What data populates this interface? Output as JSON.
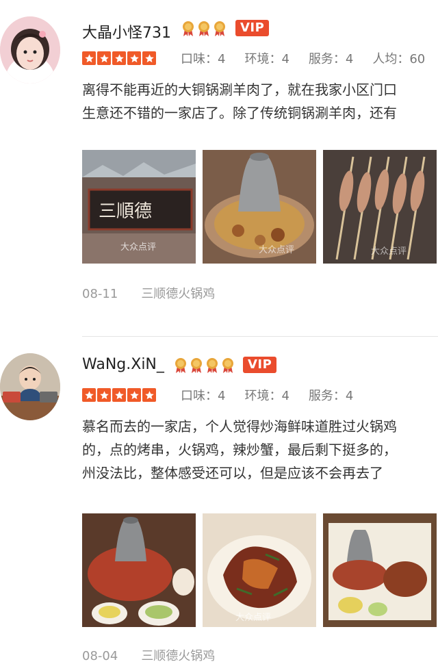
{
  "reviews": [
    {
      "username": "大晶小怪731",
      "medal_count": 3,
      "vip_label": "VIP",
      "rating_stars": 5,
      "scores": [
        "口味：4",
        "环境：4",
        "服务：4",
        "人均：60"
      ],
      "text_lines": [
        "离得不能再近的大铜锅涮羊肉了，就在我家小区门口",
        "生意还不错的一家店了。除了传统铜锅涮羊肉，还有"
      ],
      "photos": [
        "storefront-sign-photo",
        "copper-hotpot-photo",
        "lamb-skewers-photo"
      ],
      "sign_text": "三順德",
      "watermark": "大众点评",
      "date": "08-11",
      "shop": "三顺德火锅鸡"
    },
    {
      "username": "WaNg.XiN_",
      "medal_count": 4,
      "vip_label": "VIP",
      "rating_stars": 5,
      "scores": [
        "口味：4",
        "环境：4",
        "服务：4"
      ],
      "text_lines": [
        "慕名而去的一家店，个人觉得炒海鲜味道胜过火锅鸡",
        "的，点的烤串，火锅鸡，辣炒蟹，最后剩下挺多的，",
        "州没法比，整体感受还可以，但是应该不会再去了"
      ],
      "photos": [
        "hotpot-table-photo",
        "spicy-crab-plate-photo",
        "hotpot-spread-photo"
      ],
      "watermark": "大众点评",
      "date": "08-04",
      "shop": "三顺德火锅鸡"
    }
  ],
  "colors": {
    "accent": "#ea4c2d",
    "star": "#f05a28",
    "medal": "#e8a63a",
    "meta_text": "#999999"
  }
}
